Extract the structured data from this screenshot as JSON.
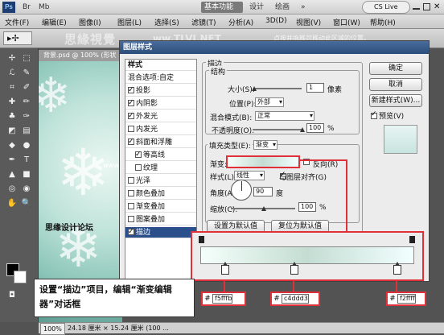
{
  "appbar": {
    "logo": "Ps",
    "right_items": [
      "Br",
      "Mb"
    ],
    "essentials": "基本功能",
    "design": "设计",
    "painting": "绘画",
    "more": "»",
    "cslive": "CS Live"
  },
  "menu": [
    "文件(F)",
    "编辑(E)",
    "图像(I)",
    "图层(L)",
    "选择(S)",
    "滤镜(T)",
    "分析(A)",
    "3D(D)",
    "视图(V)",
    "窗口(W)",
    "帮助(H)"
  ],
  "watermark": {
    "text": "思緣視覺",
    "url": "ww.TLVI.NET",
    "hint": "点按并拖移可移动此区域的位置。"
  },
  "document": {
    "tab": "背景.psd @ 100% (形状",
    "forum": "思缘设计论坛",
    "site": "www.MISSYUAN.COM",
    "zoom": "100%",
    "size": "24.18 厘米 × 15.24 厘米 (100 ..."
  },
  "dialog": {
    "title": "图层样式",
    "list_header": "样式",
    "blend_options": "混合选项:自定",
    "styles": [
      {
        "label": "投影",
        "checked": true
      },
      {
        "label": "内阴影",
        "checked": true
      },
      {
        "label": "外发光",
        "checked": true
      },
      {
        "label": "内发光",
        "checked": false
      },
      {
        "label": "斜面和浮雕",
        "checked": true
      },
      {
        "label": "等高线",
        "checked": true
      },
      {
        "label": "纹理",
        "checked": false
      },
      {
        "label": "光泽",
        "checked": false
      },
      {
        "label": "颜色叠加",
        "checked": false
      },
      {
        "label": "渐变叠加",
        "checked": false
      },
      {
        "label": "图案叠加",
        "checked": false
      },
      {
        "label": "描边",
        "checked": true
      }
    ],
    "stroke_section": "描边",
    "structure": "结构",
    "size_label": "大小(S):",
    "size_value": "1",
    "size_unit": "像素",
    "position_label": "位置(P):",
    "position_value": "外部",
    "blend_label": "混合模式(B):",
    "blend_value": "正常",
    "opacity_label": "不透明度(O):",
    "opacity_value": "100",
    "percent": "%",
    "fill_type_label": "填充类型(E):",
    "fill_type_value": "渐变",
    "gradient_label": "渐变:",
    "reverse_label": "反向(R)",
    "style_label": "样式(L):",
    "style_value": "线性",
    "align_label": "与图层对齐(G)",
    "angle_label": "角度(A):",
    "angle_value": "90",
    "angle_unit": "度",
    "scale_label": "缩放(C):",
    "scale_value": "100",
    "set_default": "设置为默认值",
    "reset_default": "复位为默认值",
    "ok": "确定",
    "cancel": "取消",
    "new_style": "新建样式(W)...",
    "preview": "预览(V)"
  },
  "gradient": {
    "stops": [
      "f5fffb",
      "c4ddd3",
      "f2ffff"
    ],
    "hash": "#"
  },
  "caption": "设置“描边”项目，编辑“渐变编辑器”对话框",
  "colors": {
    "accent": "#e0303a",
    "title": "#2c4d7b"
  }
}
